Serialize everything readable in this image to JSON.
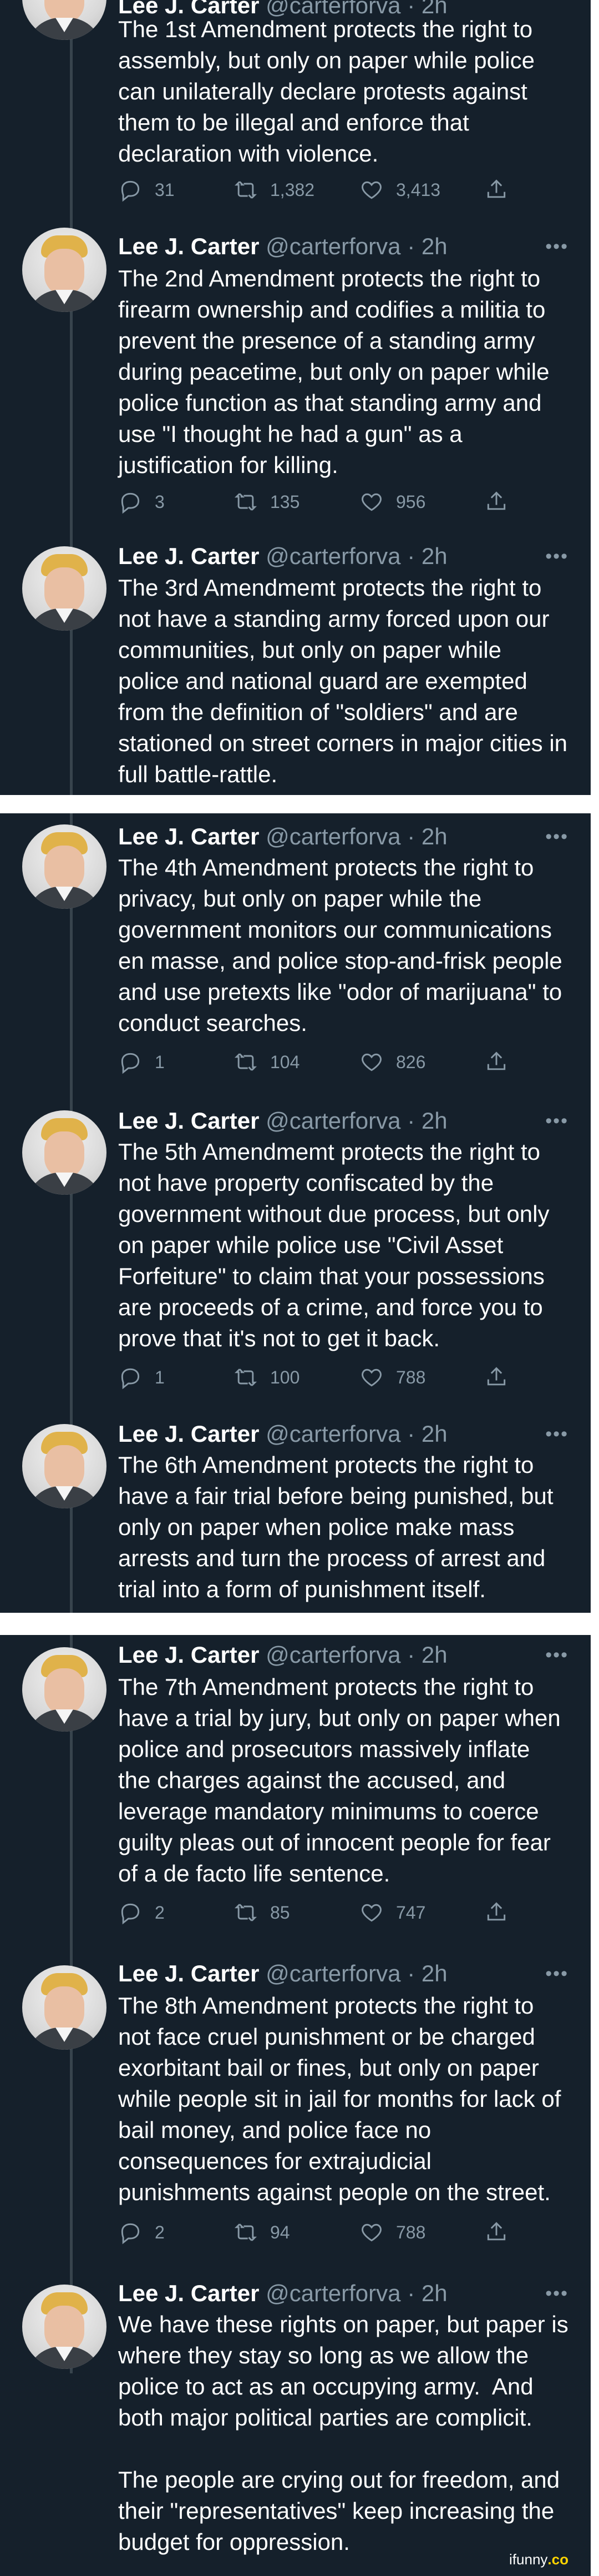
{
  "author": {
    "name": "Lee J. Carter",
    "handle": "@carterforva",
    "time": "· 2h",
    "header_partial": "Lee J. Carter @carterforva · 2h"
  },
  "icons": {
    "more": "more-horizontal-icon",
    "reply": "reply-icon",
    "retweet": "retweet-icon",
    "like": "heart-icon",
    "share": "share-icon"
  },
  "colors": {
    "background": "#15202b",
    "text": "#ffffff",
    "secondary": "#8899a6",
    "thread_line": "#38444d"
  },
  "tweets": [
    {
      "text": "The 1st Amendment protects the right to assembly, but only on paper while police can unilaterally declare protests against them to be illegal and enforce that declaration with violence.",
      "replies": "31",
      "retweets": "1,382",
      "likes": "3,413"
    },
    {
      "text": "The 2nd Amendment protects the right to firearm ownership and codifies a militia to prevent the presence of a standing army during peacetime, but only on paper while police function as that standing army and use \"I thought he had a gun\" as a justification for killing.",
      "replies": "3",
      "retweets": "135",
      "likes": "956"
    },
    {
      "text": "The 3rd Amendmemt protects the right to not have a standing army forced upon our communities, but only on paper while police and national guard are exempted from the definition of \"soldiers\" and are stationed on street corners in major cities in full battle-rattle."
    },
    {
      "text": "The 4th Amendment protects the right to privacy, but only on paper while the government monitors our communications en masse, and police stop-and-frisk people and use pretexts like \"odor of marijuana\" to conduct searches.",
      "replies": "1",
      "retweets": "104",
      "likes": "826"
    },
    {
      "text": "The 5th Amendmemt protects the right to not have property confiscated by the government without due process, but only on paper while police use \"Civil Asset Forfeiture\" to claim that your possessions are proceeds of a crime, and force you to prove that it's not to get it back.",
      "replies": "1",
      "retweets": "100",
      "likes": "788"
    },
    {
      "text": "The 6th Amendment protects the right to have a fair trial before being punished, but only on paper when police make mass arrests and turn the process of arrest and trial into a form of punishment itself."
    },
    {
      "text": "The 7th Amendment protects the right to have a trial by jury, but only on paper when police and prosecutors massively inflate the charges against the accused, and leverage mandatory minimums to coerce guilty pleas out of innocent people for fear of a de facto life sentence.",
      "replies": "2",
      "retweets": "85",
      "likes": "747"
    },
    {
      "text": "The 8th Amendment protects the right to not face cruel punishment or be charged exorbitant bail or fines, but only on paper while people sit in jail for months for lack of bail money, and police face no consequences for extrajudicial punishments against people on the street.",
      "replies": "2",
      "retweets": "94",
      "likes": "788"
    },
    {
      "text": "We have these rights on paper, but paper is where they stay so long as we allow the police to act as an occupying army.  And both major political parties are complicit.\n\nThe people are crying out for freedom, and their \"representatives\" keep increasing the budget for oppression."
    }
  ],
  "watermark": {
    "part1": "ifunny",
    "part2": ".co"
  }
}
